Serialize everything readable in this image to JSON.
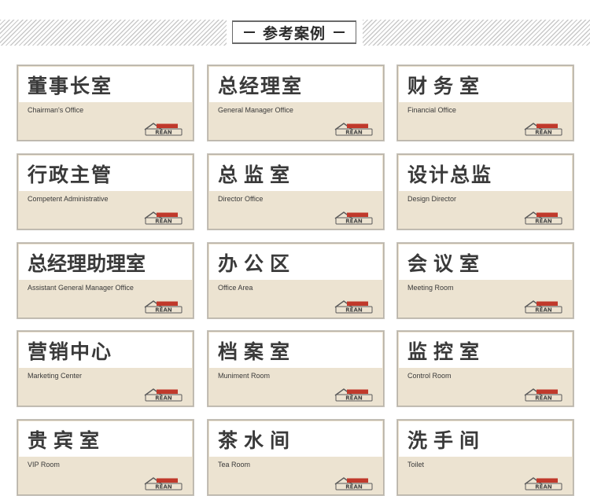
{
  "header": {
    "title": "参考案例"
  },
  "brand": {
    "logo_text": "REAN",
    "accent": "#c0392b"
  },
  "signs": [
    {
      "zh": "董事长室",
      "en": "Chairman's Office",
      "spacing": "2px"
    },
    {
      "zh": "总经理室",
      "en": "General Manager Office",
      "spacing": "2px"
    },
    {
      "zh": "财务室",
      "en": "Financial Office",
      "spacing": "8px"
    },
    {
      "zh": "行政主管",
      "en": "Competent Administrative",
      "spacing": "2px"
    },
    {
      "zh": "总监室",
      "en": "Director Office",
      "spacing": "8px"
    },
    {
      "zh": "设计总监",
      "en": "Design Director",
      "spacing": "2px"
    },
    {
      "zh": "总经理助理室",
      "en": "Assistant General Manager Office",
      "spacing": "0px"
    },
    {
      "zh": "办公区",
      "en": "Office Area",
      "spacing": "8px"
    },
    {
      "zh": "会议室",
      "en": "Meeting Room",
      "spacing": "8px"
    },
    {
      "zh": "营销中心",
      "en": "Marketing Center",
      "spacing": "2px"
    },
    {
      "zh": "档案室",
      "en": "Muniment Room",
      "spacing": "8px"
    },
    {
      "zh": "监控室",
      "en": "Control Room",
      "spacing": "8px"
    },
    {
      "zh": "贵宾室",
      "en": "VIP Room",
      "spacing": "8px"
    },
    {
      "zh": "茶水间",
      "en": "Tea Room",
      "spacing": "8px"
    },
    {
      "zh": "洗手间",
      "en": "Toilet",
      "spacing": "8px"
    }
  ]
}
